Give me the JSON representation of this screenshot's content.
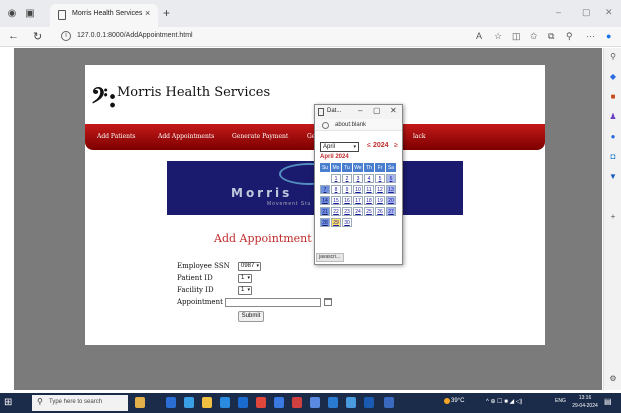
{
  "browser": {
    "tab_title": "Morris Health Services",
    "tab_close": "×",
    "new_tab": "+",
    "url": "127.0.0.1:8000/AddAppointment.html",
    "win_min": "–",
    "win_max": "▢",
    "win_close": "✕"
  },
  "site": {
    "brand": "Morris Health Services",
    "logo_glyph": "𝄢:",
    "nav": [
      "Add Patients",
      "Add Appointments",
      "Generate Payment",
      "Ge",
      "lack"
    ],
    "banner_title": "Morris",
    "banner_subtitle": "Movement Stu",
    "heading": "Add Appointment Page"
  },
  "form": {
    "ssn_label": "Employee SSN",
    "ssn_value": "0987",
    "patient_label": "Patient ID",
    "patient_value": "1",
    "facility_label": "Facility ID",
    "facility_value": "1",
    "date_label": "Appointment Date",
    "date_value": "",
    "submit_label": "Submit"
  },
  "popup": {
    "title": "Dat...",
    "min": "–",
    "max": "▢",
    "close": "✕",
    "url": "about:blank",
    "month_select": "April",
    "prev": "≤",
    "year": "2024",
    "next": "≥",
    "caption": "April 2024",
    "weekdays": [
      "Su",
      "Mo",
      "Tu",
      "We",
      "Th",
      "Fr",
      "Sa"
    ],
    "weeks": [
      [
        "",
        "1",
        "2",
        "3",
        "4",
        "5",
        "6"
      ],
      [
        "7",
        "8",
        "9",
        "10",
        "11",
        "12",
        "13"
      ],
      [
        "14",
        "15",
        "16",
        "17",
        "18",
        "19",
        "20"
      ],
      [
        "21",
        "22",
        "23",
        "24",
        "25",
        "26",
        "27"
      ],
      [
        "28",
        "29",
        "30",
        "",
        "",
        "",
        ""
      ]
    ],
    "today": "29",
    "status": "javascri..."
  },
  "taskbar": {
    "search_placeholder": "Type here to search",
    "weather": "39°C",
    "tray": "^ ⊕ ☐ ■ ◢ ◁)",
    "lang": "ENG",
    "time": "13:16",
    "date": "29-04-2024"
  },
  "colors": {
    "nav_red": "#a00000",
    "heading_red": "#c02a2a",
    "banner_navy": "#1a1a6e",
    "taskbar": "#1b2b4a"
  }
}
